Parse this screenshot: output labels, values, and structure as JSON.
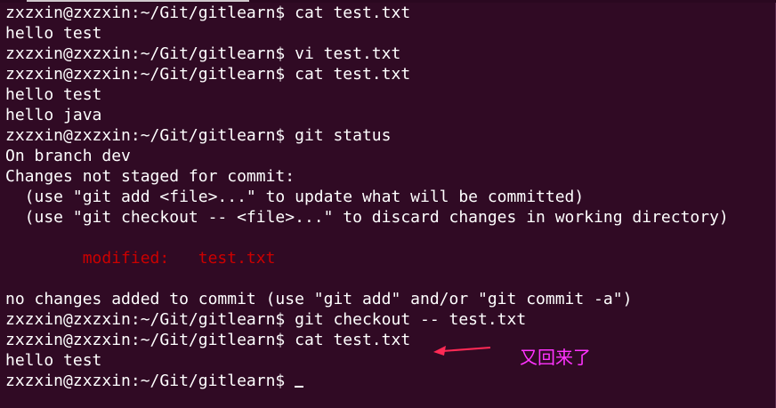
{
  "terminal": {
    "lines": [
      {
        "segments": [
          {
            "text": "zxzxin@zxzxin:~/Git/gitlearn$ cat test.txt",
            "color": "default"
          }
        ]
      },
      {
        "segments": [
          {
            "text": "hello test",
            "color": "default"
          }
        ]
      },
      {
        "segments": [
          {
            "text": "zxzxin@zxzxin:~/Git/gitlearn$ vi test.txt",
            "color": "default"
          }
        ]
      },
      {
        "segments": [
          {
            "text": "zxzxin@zxzxin:~/Git/gitlearn$ cat test.txt",
            "color": "default"
          }
        ]
      },
      {
        "segments": [
          {
            "text": "hello test",
            "color": "default"
          }
        ]
      },
      {
        "segments": [
          {
            "text": "hello java",
            "color": "default"
          }
        ]
      },
      {
        "segments": [
          {
            "text": "zxzxin@zxzxin:~/Git/gitlearn$ git status",
            "color": "default"
          }
        ]
      },
      {
        "segments": [
          {
            "text": "On branch dev",
            "color": "default"
          }
        ]
      },
      {
        "segments": [
          {
            "text": "Changes not staged for commit:",
            "color": "default"
          }
        ]
      },
      {
        "segments": [
          {
            "text": "  (use \"git add <file>...\" to update what will be committed)",
            "color": "default"
          }
        ]
      },
      {
        "segments": [
          {
            "text": "  (use \"git checkout -- <file>...\" to discard changes in working directory)",
            "color": "default"
          }
        ]
      },
      {
        "segments": [
          {
            "text": "",
            "color": "default"
          }
        ]
      },
      {
        "segments": [
          {
            "text": "        ",
            "color": "default"
          },
          {
            "text": "modified:   test.txt",
            "color": "red"
          }
        ]
      },
      {
        "segments": [
          {
            "text": "",
            "color": "default"
          }
        ]
      },
      {
        "segments": [
          {
            "text": "no changes added to commit (use \"git add\" and/or \"git commit -a\")",
            "color": "default"
          }
        ]
      },
      {
        "segments": [
          {
            "text": "zxzxin@zxzxin:~/Git/gitlearn$ git checkout -- test.txt",
            "color": "default"
          }
        ]
      },
      {
        "segments": [
          {
            "text": "zxzxin@zxzxin:~/Git/gitlearn$ cat test.txt",
            "color": "default"
          }
        ]
      },
      {
        "segments": [
          {
            "text": "hello test",
            "color": "default"
          }
        ]
      },
      {
        "segments": [
          {
            "text": "zxzxin@zxzxin:~/Git/gitlearn$ ",
            "color": "default"
          }
        ],
        "cursor": true
      }
    ],
    "colors": {
      "background": "#300a24",
      "text": "#ffffff",
      "modified": "#cc0000"
    }
  },
  "annotation": {
    "note": "又回来了",
    "arrow_icon": "left-arrow-icon",
    "color": "#ff33ff",
    "arrow_color": "#ff2a55"
  }
}
